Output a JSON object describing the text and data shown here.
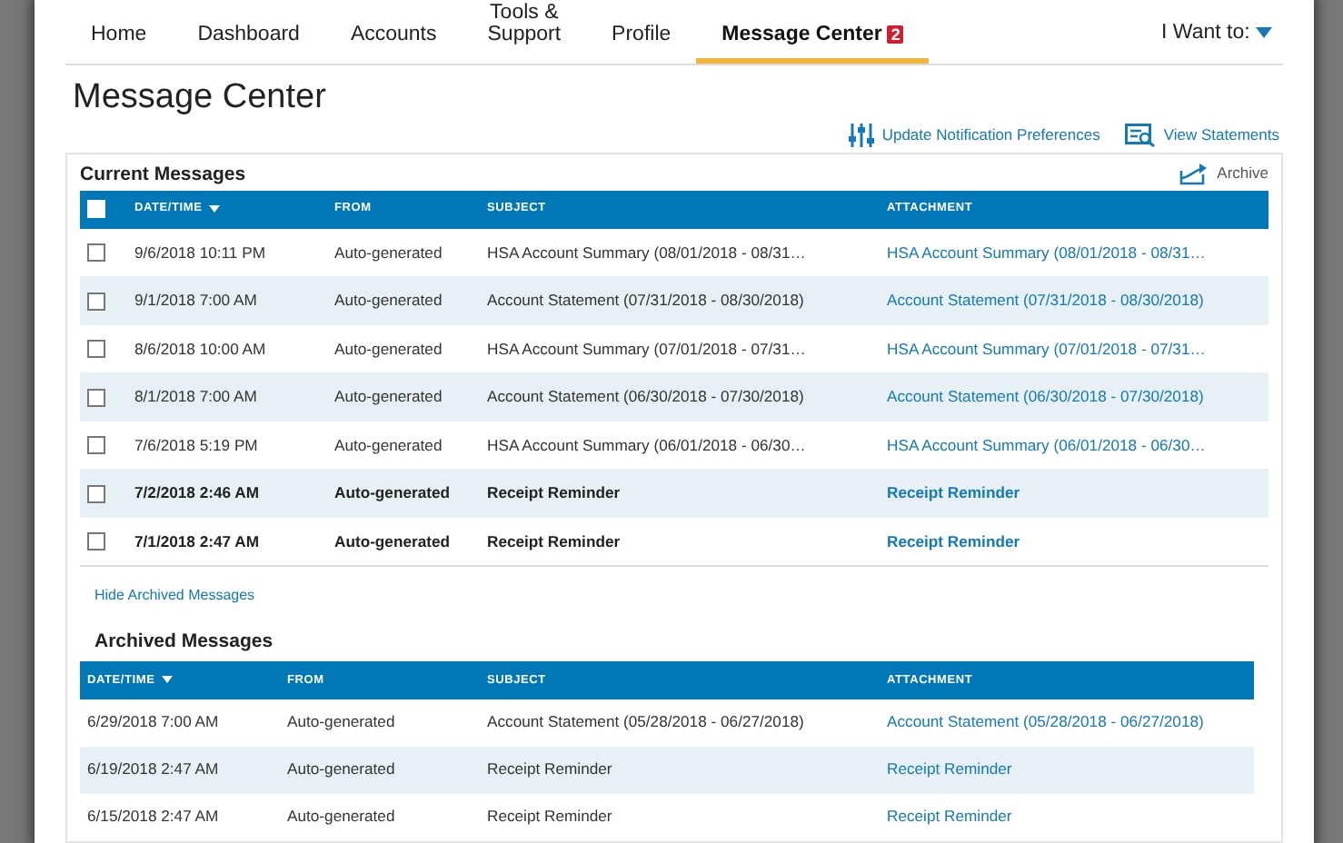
{
  "nav": {
    "items": [
      {
        "label": "Home",
        "selected": false
      },
      {
        "label": "Dashboard",
        "selected": false
      },
      {
        "label": "Accounts",
        "selected": false
      },
      {
        "label": "Tools &\nSupport",
        "selected": false
      },
      {
        "label": "Profile",
        "selected": false
      },
      {
        "label": "Message Center",
        "selected": true,
        "badge": "2"
      }
    ],
    "menu": "I Want to:"
  },
  "page_title": "Message Center",
  "actions": [
    {
      "kind": "preferences",
      "label": "Update Notification Preferences"
    },
    {
      "kind": "statements",
      "label": "View Statements"
    }
  ],
  "current": {
    "title": "Current Messages",
    "archive": "Archive",
    "select_all": {
      "checked": false
    },
    "columns": [
      "DATE/TIME",
      "FROM",
      "SUBJECT",
      "ATTACHMENT"
    ],
    "rows": [
      {
        "checked": false,
        "unread": false,
        "date": "9/6/2018 10:11 PM",
        "from": "Auto-generated",
        "subject": "HSA Account Summary (08/01/2018 - 08/31…",
        "attachment": "HSA Account Summary (08/01/2018 - 08/31…"
      },
      {
        "checked": false,
        "unread": false,
        "date": "9/1/2018 7:00 AM",
        "from": "Auto-generated",
        "subject": "Account Statement (07/31/2018 - 08/30/2018)",
        "attachment": "Account Statement (07/31/2018 - 08/30/2018)"
      },
      {
        "checked": false,
        "unread": false,
        "date": "8/6/2018 10:00 AM",
        "from": "Auto-generated",
        "subject": "HSA Account Summary (07/01/2018 - 07/31…",
        "attachment": "HSA Account Summary (07/01/2018 - 07/31…"
      },
      {
        "checked": false,
        "unread": false,
        "date": "8/1/2018 7:00 AM",
        "from": "Auto-generated",
        "subject": "Account Statement (06/30/2018 - 07/30/2018)",
        "attachment": "Account Statement (06/30/2018 - 07/30/2018)"
      },
      {
        "checked": false,
        "unread": false,
        "date": "7/6/2018 5:19 PM",
        "from": "Auto-generated",
        "subject": "HSA Account Summary (06/01/2018 - 06/30…",
        "attachment": "HSA Account Summary (06/01/2018 - 06/30…"
      },
      {
        "checked": false,
        "unread": true,
        "date": "7/2/2018 2:46 AM",
        "from": "Auto-generated",
        "subject": "Receipt Reminder",
        "attachment": "Receipt Reminder"
      },
      {
        "checked": false,
        "unread": true,
        "date": "7/1/2018 2:47 AM",
        "from": "Auto-generated",
        "subject": "Receipt Reminder",
        "attachment": "Receipt Reminder"
      }
    ]
  },
  "hide_archived": "Hide Archived Messages",
  "archived": {
    "title": "Archived Messages",
    "columns": [
      "DATE/TIME",
      "FROM",
      "SUBJECT",
      "ATTACHMENT"
    ],
    "rows": [
      {
        "date": "6/29/2018 7:00 AM",
        "from": "Auto-generated",
        "subject": "Account Statement (05/28/2018 - 06/27/2018)",
        "attachment": "Account Statement (05/28/2018 - 06/27/2018)"
      },
      {
        "date": "6/19/2018 2:47 AM",
        "from": "Auto-generated",
        "subject": "Receipt Reminder",
        "attachment": "Receipt Reminder"
      },
      {
        "date": "6/15/2018 2:47 AM",
        "from": "Auto-generated",
        "subject": "Receipt Reminder",
        "attachment": "Receipt Reminder"
      }
    ]
  }
}
